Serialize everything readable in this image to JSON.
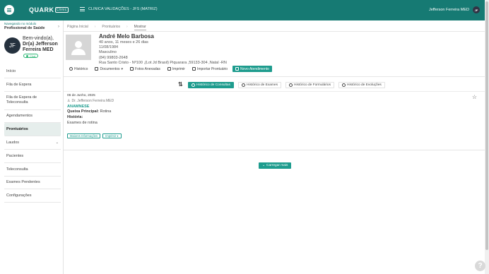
{
  "header": {
    "logo": "QUARK",
    "logo_badge": "Clinic",
    "clinic": "CLINICA VALIDAÇÕES - JFS (MATRIZ)",
    "user": "Jefferson Ferreira MED",
    "user_initials": "JF"
  },
  "sidebar": {
    "module_caption": "Navegando no módulo",
    "module_name": "Profissional de Saúde",
    "welcome": "Bem-vindo(a),",
    "doctor_name": "Dr(a) Jefferson Ferreira MED",
    "initials": "JF",
    "chat": "Chat",
    "items": [
      {
        "label": "Início"
      },
      {
        "label": "Fila de Espera"
      },
      {
        "label": "Fila de Espera de Teleconsulta"
      },
      {
        "label": "Agendamentos"
      },
      {
        "label": "Prontuários"
      },
      {
        "label": "Laudos"
      },
      {
        "label": "Pacientes"
      },
      {
        "label": "Teleconsulta"
      },
      {
        "label": "Exames Pendentes"
      },
      {
        "label": "Configurações"
      }
    ]
  },
  "breadcrumb": [
    "Página Inicial",
    "Prontuários",
    "Mostrar"
  ],
  "patient": {
    "name": "André Melo Barbosa",
    "age": "40 anos, 11 meses e 26 dias",
    "birth": "11/08/1984",
    "sex": "Masculino",
    "phone": "(84) 99803-2648",
    "address": "Rua Santo Cristo - Nº100 ,(Lot Jd Brasil) Piquarara ,59133-304 ,Natal -RN"
  },
  "actions": {
    "historico": "Histórico",
    "documentos": "Documentos",
    "fotos": "Fotos Anexadas",
    "imprimir": "Imprimir",
    "importar": "Importar Prontuário",
    "novo": "Novo Atendimento"
  },
  "tabs": [
    "Histórico de Consultas",
    "Histórico de Exames",
    "Histórico de Formulários",
    "Histórico de Evoluções"
  ],
  "entry": {
    "date": "06 de Junho, 2025",
    "doctor": "Dr. Jefferson Ferreira MED",
    "category": "ANAMNESE",
    "complaint_label": "Queixa Principal:",
    "complaint_value": "Rotina",
    "history_label": "História:",
    "history_value": "Exames de rotina",
    "btn_more": "Maiores Informações",
    "btn_print": "Imprimir"
  },
  "load_more": "Carregar mais",
  "help": "?"
}
